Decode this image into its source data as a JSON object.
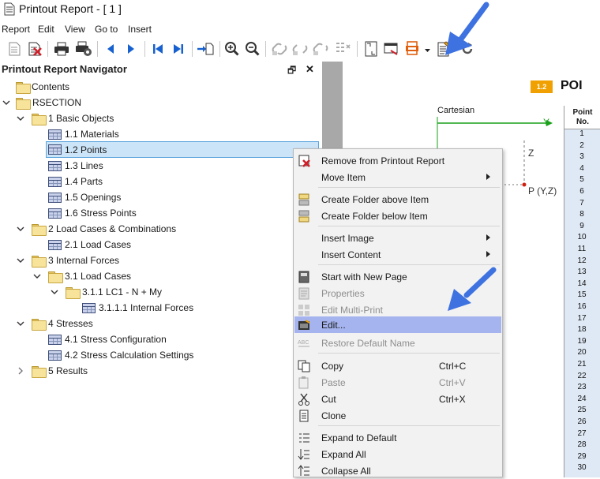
{
  "window": {
    "title": "Printout Report - [ 1 ]"
  },
  "menu": [
    "Report",
    "Edit",
    "View",
    "Go to",
    "Insert"
  ],
  "toolbar": {
    "icons": [
      "new-report-icon",
      "delete-report-icon",
      "print-icon",
      "print-setup-icon",
      "previous-icon",
      "next-icon",
      "first-page-icon",
      "last-page-icon",
      "go-to-page-icon",
      "zoom-in-icon",
      "zoom-out-icon",
      "link-icon",
      "unlink-icon",
      "relink-icon",
      "grid-icon",
      "page-setup-icon",
      "layout-icon",
      "export-icon",
      "edit-selected-icon",
      "refresh-icon"
    ]
  },
  "navigator": {
    "title": "Printout Report Navigator",
    "pin_symbol": "🗗",
    "close_symbol": "✕",
    "items": [
      {
        "label": "Contents"
      },
      {
        "label": "RSECTION"
      },
      {
        "label": "1 Basic Objects"
      },
      {
        "label": "1.1 Materials"
      },
      {
        "label": "1.2 Points"
      },
      {
        "label": "1.3 Lines"
      },
      {
        "label": "1.4 Parts"
      },
      {
        "label": "1.5 Openings"
      },
      {
        "label": "1.6 Stress Points"
      },
      {
        "label": "2 Load Cases & Combinations"
      },
      {
        "label": "2.1 Load Cases"
      },
      {
        "label": "3 Internal Forces"
      },
      {
        "label": "3.1 Load Cases"
      },
      {
        "label": "3.1.1 LC1 - N + My"
      },
      {
        "label": "3.1.1.1 Internal Forces"
      },
      {
        "label": "4 Stresses"
      },
      {
        "label": "4.1 Stress Configuration"
      },
      {
        "label": "4.2 Stress Calculation Settings"
      },
      {
        "label": "5 Results"
      }
    ]
  },
  "context_menu": {
    "items": [
      {
        "label": "Remove from Printout Report",
        "shortcut": ""
      },
      {
        "label": "Move Item",
        "shortcut": ""
      },
      {
        "label": "Create Folder above Item",
        "shortcut": ""
      },
      {
        "label": "Create Folder below Item",
        "shortcut": ""
      },
      {
        "label": "Insert Image",
        "shortcut": ""
      },
      {
        "label": "Insert Content",
        "shortcut": ""
      },
      {
        "label": "Start with New Page",
        "shortcut": ""
      },
      {
        "label": "Properties",
        "shortcut": ""
      },
      {
        "label": "Edit Multi-Print",
        "shortcut": ""
      },
      {
        "label": "Edit...",
        "shortcut": ""
      },
      {
        "label": "Restore Default Name",
        "shortcut": ""
      },
      {
        "label": "Copy",
        "shortcut": "Ctrl+C"
      },
      {
        "label": "Paste",
        "shortcut": "Ctrl+V"
      },
      {
        "label": "Cut",
        "shortcut": "Ctrl+X"
      },
      {
        "label": "Clone",
        "shortcut": ""
      },
      {
        "label": "Expand to Default",
        "shortcut": ""
      },
      {
        "label": "Expand All",
        "shortcut": ""
      },
      {
        "label": "Collapse All",
        "shortcut": ""
      }
    ]
  },
  "preview": {
    "section_badge": "1.2",
    "section_title": "POI",
    "diagram": {
      "system_label": "Cartesian",
      "y_axis": "Y",
      "z_axis": "Z",
      "point_label": "P (Y,Z)"
    },
    "table_header_line1": "Point",
    "table_header_line2": "No.",
    "point_numbers": [
      "1",
      "2",
      "3",
      "4",
      "5",
      "6",
      "7",
      "8",
      "9",
      "10",
      "11",
      "12",
      "13",
      "14",
      "15",
      "16",
      "17",
      "18",
      "19",
      "20",
      "21",
      "22",
      "23",
      "24",
      "25",
      "26",
      "27",
      "28",
      "29",
      "30"
    ]
  },
  "colors": {
    "accent_orange": "#f0a000",
    "annotation_arrow": "#3d72e0",
    "highlight": "#a5b4ee",
    "selection": "#cce4f7"
  }
}
